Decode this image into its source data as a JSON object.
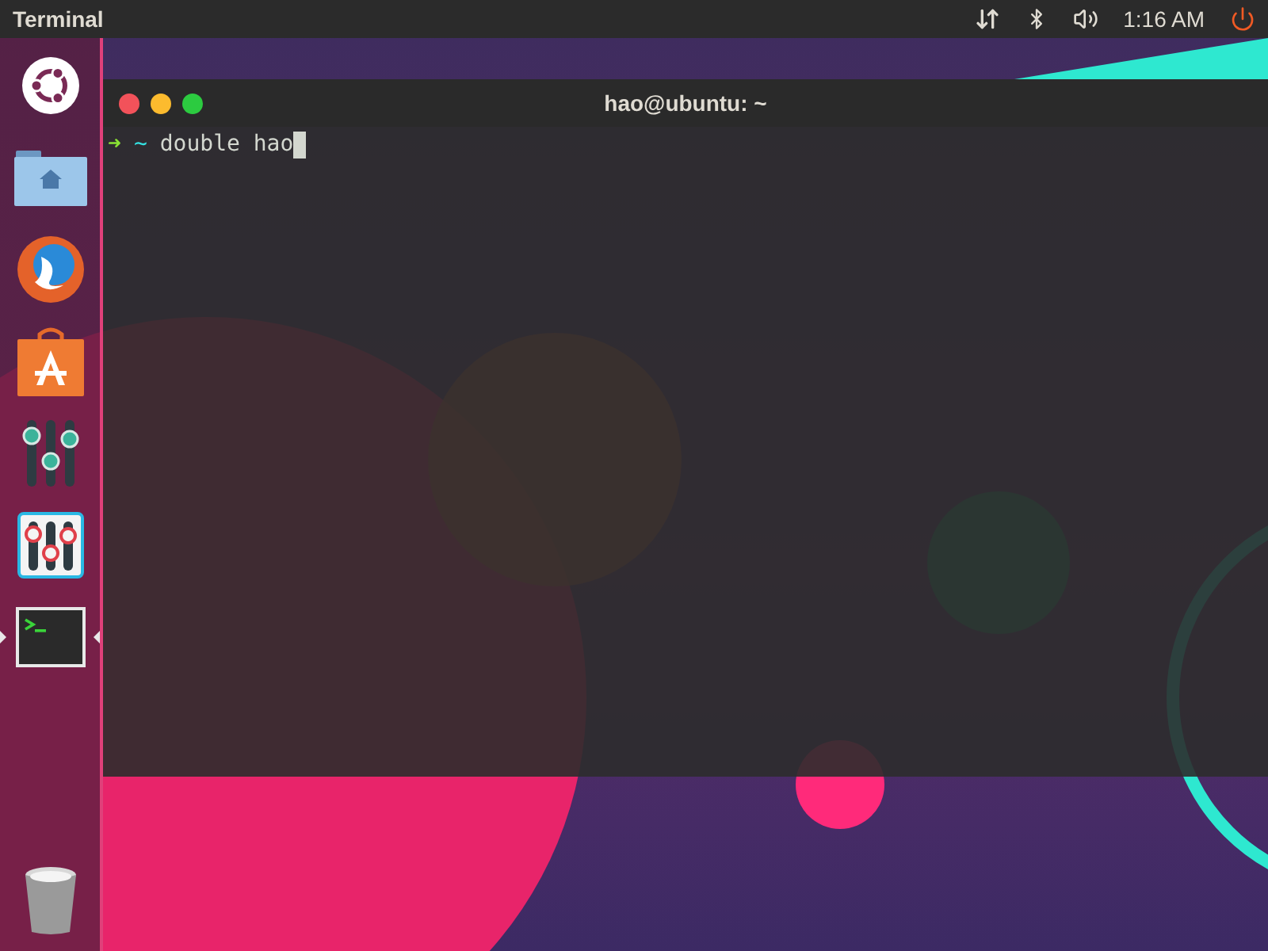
{
  "top_bar": {
    "app_title": "Terminal",
    "clock": "1:16 AM"
  },
  "launcher": {
    "items": [
      {
        "kind": "ubuntu",
        "running": false,
        "focused": false
      },
      {
        "kind": "files",
        "running": false,
        "focused": false
      },
      {
        "kind": "firefox",
        "running": false,
        "focused": false
      },
      {
        "kind": "software",
        "running": false,
        "focused": false
      },
      {
        "kind": "mixer",
        "running": false,
        "focused": false
      },
      {
        "kind": "settings-mixer",
        "running": false,
        "focused": false
      },
      {
        "kind": "terminal",
        "running": true,
        "focused": true
      }
    ],
    "trash": {
      "kind": "trash"
    }
  },
  "terminal": {
    "title": "hao@ubuntu: ~",
    "prompt_arrow": "➜",
    "cwd": "~",
    "command": "double hao"
  }
}
